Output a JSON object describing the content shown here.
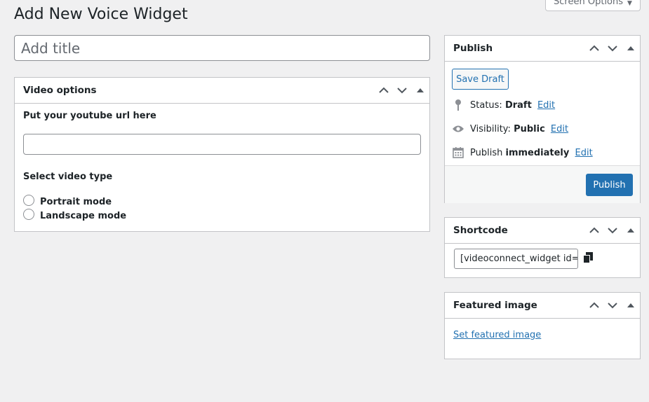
{
  "page": {
    "title": "Add New Voice Widget"
  },
  "screen_options": {
    "label": "Screen Options"
  },
  "title_field": {
    "placeholder": "Add title",
    "value": ""
  },
  "video_box": {
    "title": "Video options",
    "url_label": "Put your youtube url here",
    "url_value": "",
    "type_label": "Select video type",
    "options": [
      {
        "label": "Portrait mode",
        "selected": false
      },
      {
        "label": "Landscape mode",
        "selected": false
      }
    ]
  },
  "publish_box": {
    "title": "Publish",
    "save_draft": "Save Draft",
    "status_label": "Status:",
    "status_value": "Draft",
    "visibility_label": "Visibility:",
    "visibility_value": "Public",
    "publish_label": "Publish",
    "publish_value": "immediately",
    "edit": "Edit",
    "publish_button": "Publish"
  },
  "shortcode_box": {
    "title": "Shortcode",
    "value": "[videoconnect_widget id="
  },
  "featured_box": {
    "title": "Featured image",
    "link": "Set featured image"
  },
  "icons": {
    "move_up": "chevron-up-icon",
    "move_down": "chevron-down-icon",
    "toggle": "triangle-up-icon",
    "status": "pin-icon",
    "visibility": "eye-icon",
    "schedule": "calendar-icon",
    "copy": "copy-icon"
  },
  "colors": {
    "accent": "#2271b1",
    "background": "#f0f0f1",
    "border": "#c3c4c7"
  }
}
